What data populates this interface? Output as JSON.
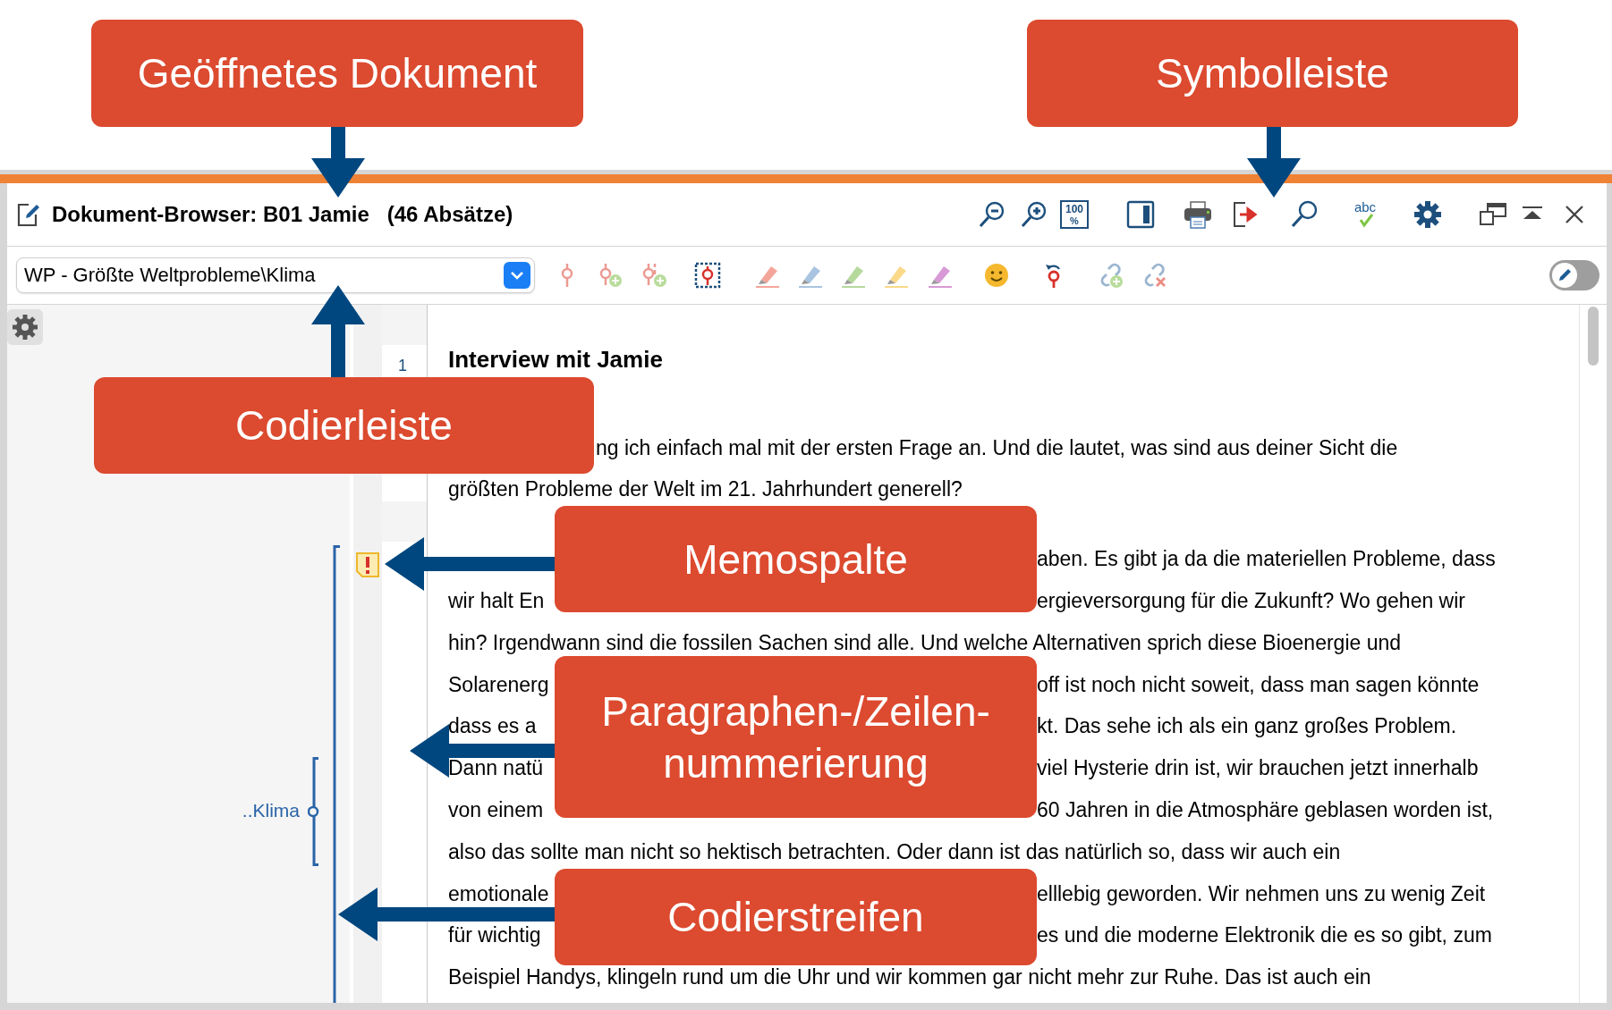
{
  "callouts": [
    {
      "label": "Geöffnetes Dokument"
    },
    {
      "label": "Symbolleiste"
    },
    {
      "label": "Codierleiste"
    },
    {
      "label": "Memospalte"
    },
    {
      "label": "Paragraphen-/Zeilen-\nnummerierung"
    },
    {
      "label": "Codierstreifen"
    }
  ],
  "window": {
    "title": "Dokument-Browser: B01 Jamie",
    "subtitle": "(46 Absätze)"
  },
  "toolbar": {
    "zoom_reset_icon": [
      "100",
      "%"
    ],
    "spellcheck_icon": "abc"
  },
  "coding_bar": {
    "code_dropdown": {
      "value": "WP - Größte Weltprobleme\\Klima"
    },
    "edit_toggle": {
      "on": false
    }
  },
  "coding_stripes": [
    {
      "label": "..Klima"
    }
  ],
  "document": {
    "line_number": "1",
    "paragraphs": [
      {
        "kind": "heading",
        "lines": [
          [
            {
              "kind": "full",
              "text": "Interview mit Jamie"
            }
          ]
        ]
      },
      {
        "kind": "body",
        "lines": [
          [
            {
              "kind": "mid",
              "text": "ng ich einfach mal mit der ersten Frage an. Und die lautet, was sind aus deiner Sicht die"
            }
          ],
          [
            {
              "kind": "full",
              "text": "größten Probleme der Welt im 21. Jahrhundert generell?"
            }
          ]
        ]
      },
      {
        "kind": "body",
        "lines": [
          [
            {
              "kind": "end",
              "text": "aben. Es gibt ja da die materiellen Probleme, dass"
            }
          ],
          [
            {
              "kind": "start",
              "text": "wir halt En"
            },
            {
              "kind": "end",
              "text": "ergieversorgung für die Zukunft? Wo gehen wir"
            }
          ],
          [
            {
              "kind": "full",
              "text": "hin? Irgendwann sind die fossilen Sachen sind alle. Und welche Alternativen sprich diese Bioenergie und"
            }
          ],
          [
            {
              "kind": "start",
              "text": "Solarenerg"
            },
            {
              "kind": "end",
              "text": "off ist noch nicht soweit, dass man sagen könnte"
            }
          ],
          [
            {
              "kind": "start",
              "text": "dass es a"
            },
            {
              "kind": "end",
              "text": "kt. Das sehe ich als ein ganz großes Problem."
            }
          ],
          [
            {
              "kind": "start",
              "text": "Dann natü"
            },
            {
              "kind": "end",
              "text": "viel Hysterie drin ist, wir brauchen jetzt innerhalb"
            }
          ],
          [
            {
              "kind": "start",
              "text": "von einem"
            },
            {
              "kind": "end",
              "text": "60 Jahren in die Atmosphäre geblasen worden ist,"
            }
          ],
          [
            {
              "kind": "full",
              "text": "also das sollte man nicht so hektisch betrachten. Oder dann ist das natürlich so, dass wir auch ein"
            }
          ],
          [
            {
              "kind": "start",
              "text": "emotionale"
            },
            {
              "kind": "end",
              "text": "elllebig geworden. Wir nehmen uns zu wenig Zeit"
            }
          ],
          [
            {
              "kind": "start",
              "text": "für wichtig"
            },
            {
              "kind": "end",
              "text": "es und die moderne Elektronik die es so gibt, zum"
            }
          ],
          [
            {
              "kind": "full",
              "text": "Beispiel Handys, klingeln rund um die Uhr und wir kommen gar nicht mehr zur Ruhe. Das ist auch ein"
            }
          ]
        ]
      }
    ]
  }
}
